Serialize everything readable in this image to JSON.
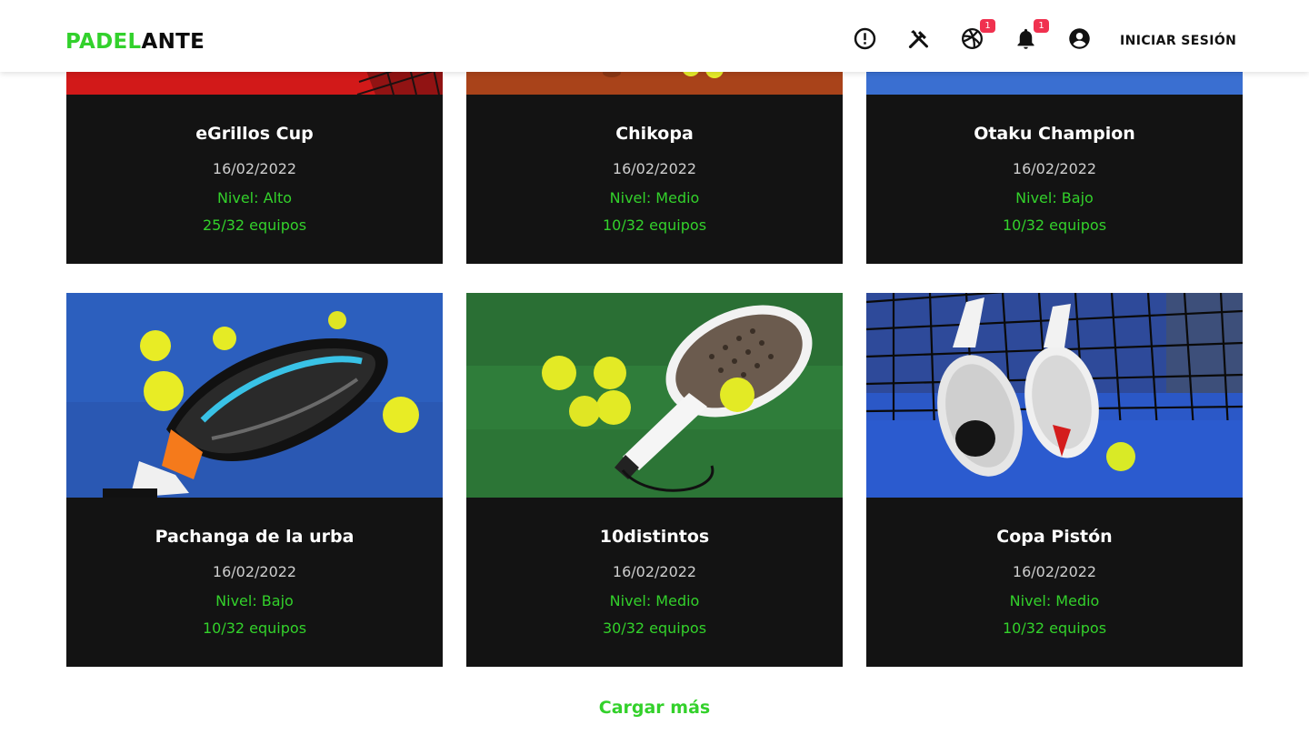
{
  "header": {
    "logo_part1": "PADEL",
    "logo_part2": "ANTE",
    "icons": [
      {
        "name": "alert-circle-icon",
        "badge": ""
      },
      {
        "name": "tools-icon",
        "badge": ""
      },
      {
        "name": "sports-ball-icon",
        "badge": "1"
      },
      {
        "name": "bell-icon",
        "badge": "1"
      },
      {
        "name": "account-circle-icon",
        "badge": ""
      }
    ],
    "login_label": "INICIAR SESIÓN"
  },
  "tournaments": [
    {
      "title": "eGrillos Cup",
      "date": "16/02/2022",
      "level": "Nivel: Alto",
      "teams": "25/32 equipos",
      "image": "red court with net"
    },
    {
      "title": "Chikopa",
      "date": "16/02/2022",
      "level": "Nivel: Medio",
      "teams": "10/32 equipos",
      "image": "clay court with balls"
    },
    {
      "title": "Otaku Champion",
      "date": "16/02/2022",
      "level": "Nivel: Bajo",
      "teams": "10/32 equipos",
      "image": "blue court"
    },
    {
      "title": "Pachanga de la urba",
      "date": "16/02/2022",
      "level": "Nivel: Bajo",
      "teams": "10/32 equipos",
      "image": "racket and balls on blue court"
    },
    {
      "title": "10distintos",
      "date": "16/02/2022",
      "level": "Nivel: Medio",
      "teams": "30/32 equipos",
      "image": "racket and balls on green grass"
    },
    {
      "title": "Copa Pistón",
      "date": "16/02/2022",
      "level": "Nivel: Medio",
      "teams": "10/32 equipos",
      "image": "rackets against net on blue court"
    }
  ],
  "load_more_label": "Cargar más",
  "colors": {
    "accent": "#33d12b",
    "card_bg": "#131313",
    "badge": "#f0314f"
  }
}
